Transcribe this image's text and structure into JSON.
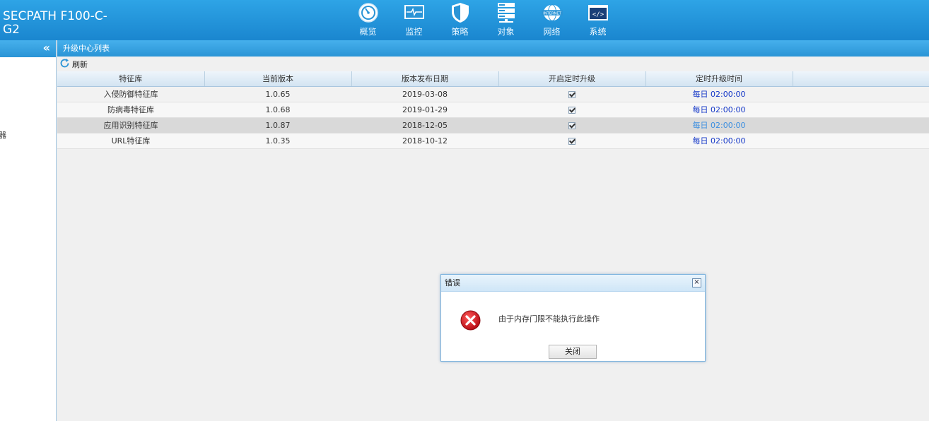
{
  "header": {
    "brand": "SECPATH F100-C-G2",
    "nav": [
      {
        "label": "概览",
        "icon": "gauge-icon"
      },
      {
        "label": "监控",
        "icon": "monitor-pulse-icon"
      },
      {
        "label": "策略",
        "icon": "shield-icon"
      },
      {
        "label": "对象",
        "icon": "server-stack-icon"
      },
      {
        "label": "网络",
        "icon": "internet-globe-icon"
      },
      {
        "label": "系统",
        "icon": "code-window-icon"
      }
    ],
    "active_nav": "系统"
  },
  "sidebar": {
    "collapse_glyph": "«",
    "fragment_text": "器"
  },
  "panel": {
    "title": "升级中心列表",
    "refresh_label": "刷新",
    "columns": [
      "特征库",
      "当前版本",
      "版本发布日期",
      "开启定时升级",
      "定时升级时间"
    ],
    "rows": [
      {
        "name": "入侵防御特征库",
        "version": "1.0.65",
        "date": "2019-03-08",
        "scheduled": true,
        "time": "每日 02:00:00"
      },
      {
        "name": "防病毒特征库",
        "version": "1.0.68",
        "date": "2019-01-29",
        "scheduled": true,
        "time": "每日 02:00:00"
      },
      {
        "name": "应用识别特征库",
        "version": "1.0.87",
        "date": "2018-12-05",
        "scheduled": true,
        "time": "每日 02:00:00"
      },
      {
        "name": "URL特征库",
        "version": "1.0.35",
        "date": "2018-10-12",
        "scheduled": true,
        "time": "每日 02:00:00"
      }
    ]
  },
  "dialog": {
    "title": "错误",
    "message": "由于内存门限不能执行此操作",
    "close_button": "关闭",
    "close_glyph": "×"
  },
  "colors": {
    "header_blue": "#1a86cf",
    "bar_blue": "#2a94d6",
    "schedule_text": "#1538c8",
    "error_red": "#d3121b"
  }
}
